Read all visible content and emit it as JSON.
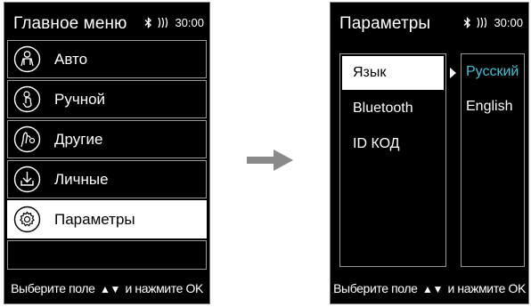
{
  "left_screen": {
    "title": "Главное меню",
    "status": {
      "time": "30:00",
      "bluetooth_icon": "bluetooth-icon",
      "signal_icon": "wireless-signal-icon"
    },
    "menu": [
      {
        "label": "Авто",
        "icon": "person-icon",
        "selected": false
      },
      {
        "label": "Ручной",
        "icon": "hand-pointer-icon",
        "selected": false
      },
      {
        "label": "Другие",
        "icon": "hand-gesture-icon",
        "selected": false
      },
      {
        "label": "Личные",
        "icon": "download-icon",
        "selected": false
      },
      {
        "label": "Параметры",
        "icon": "gear-icon",
        "selected": true
      }
    ],
    "footer": {
      "prefix": "Выберите поле",
      "arrows": "▲▼",
      "suffix": "и нажмите OK"
    }
  },
  "right_screen": {
    "title": "Параметры",
    "status": {
      "time": "30:00"
    },
    "params": [
      {
        "label": "Язык",
        "selected": true
      },
      {
        "label": "Bluetooth",
        "selected": false
      },
      {
        "label": "ID КОД",
        "selected": false
      }
    ],
    "languages": [
      {
        "label": "Русский",
        "active": true
      },
      {
        "label": "English",
        "active": false
      }
    ],
    "footer": {
      "prefix": "Выберите поле",
      "arrows": "▲▼",
      "suffix": "и нажмите OK"
    }
  },
  "colors": {
    "screen_bg": "#000000",
    "highlight": "#ffffff",
    "active_lang": "#3fc2d8",
    "arrow": "#8a8a8a"
  }
}
